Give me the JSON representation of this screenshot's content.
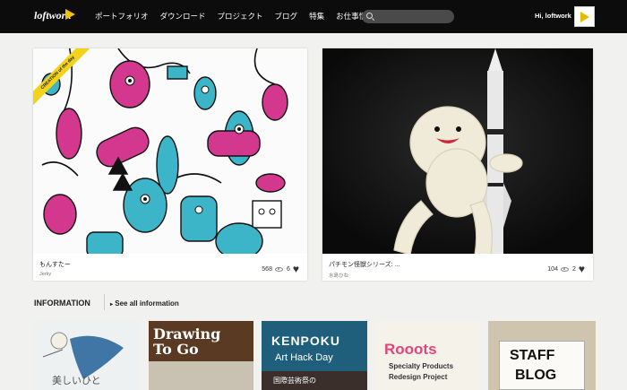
{
  "header": {
    "logo_text": "loftwork",
    "nav": [
      "ポートフォリオ",
      "ダウンロード",
      "プロジェクト",
      "ブログ",
      "特集",
      "お仕事情報"
    ],
    "search_placeholder": "",
    "greeting": "Hi, loftwork"
  },
  "cards": [
    {
      "ribbon": "CREATION of the day",
      "title": "もんすたー",
      "author": "Jerky",
      "views": "568",
      "likes": "6"
    },
    {
      "title": "パチモン怪獣シリーズ: ...",
      "author": "水島ひね",
      "views": "104",
      "likes": "2"
    }
  ],
  "info": {
    "heading": "INFORMATION",
    "link": "See all information",
    "tiles": [
      {
        "text": "美しいひと"
      },
      {
        "text": "Drawing To Go"
      },
      {
        "line1": "KENPOKU",
        "line2": "Art Hack Day",
        "line3": "国際芸術祭の"
      },
      {
        "line1": "Rooots",
        "line2": "Specialty Products",
        "line3": "Redesign Project"
      },
      {
        "line1": "STAFF",
        "line2": "BLOG"
      }
    ]
  },
  "colors": {
    "topbar": "#0c0c0c",
    "accent": "#f2c200",
    "monster_pink": "#d4388e",
    "monster_blue": "#3db5c9"
  }
}
